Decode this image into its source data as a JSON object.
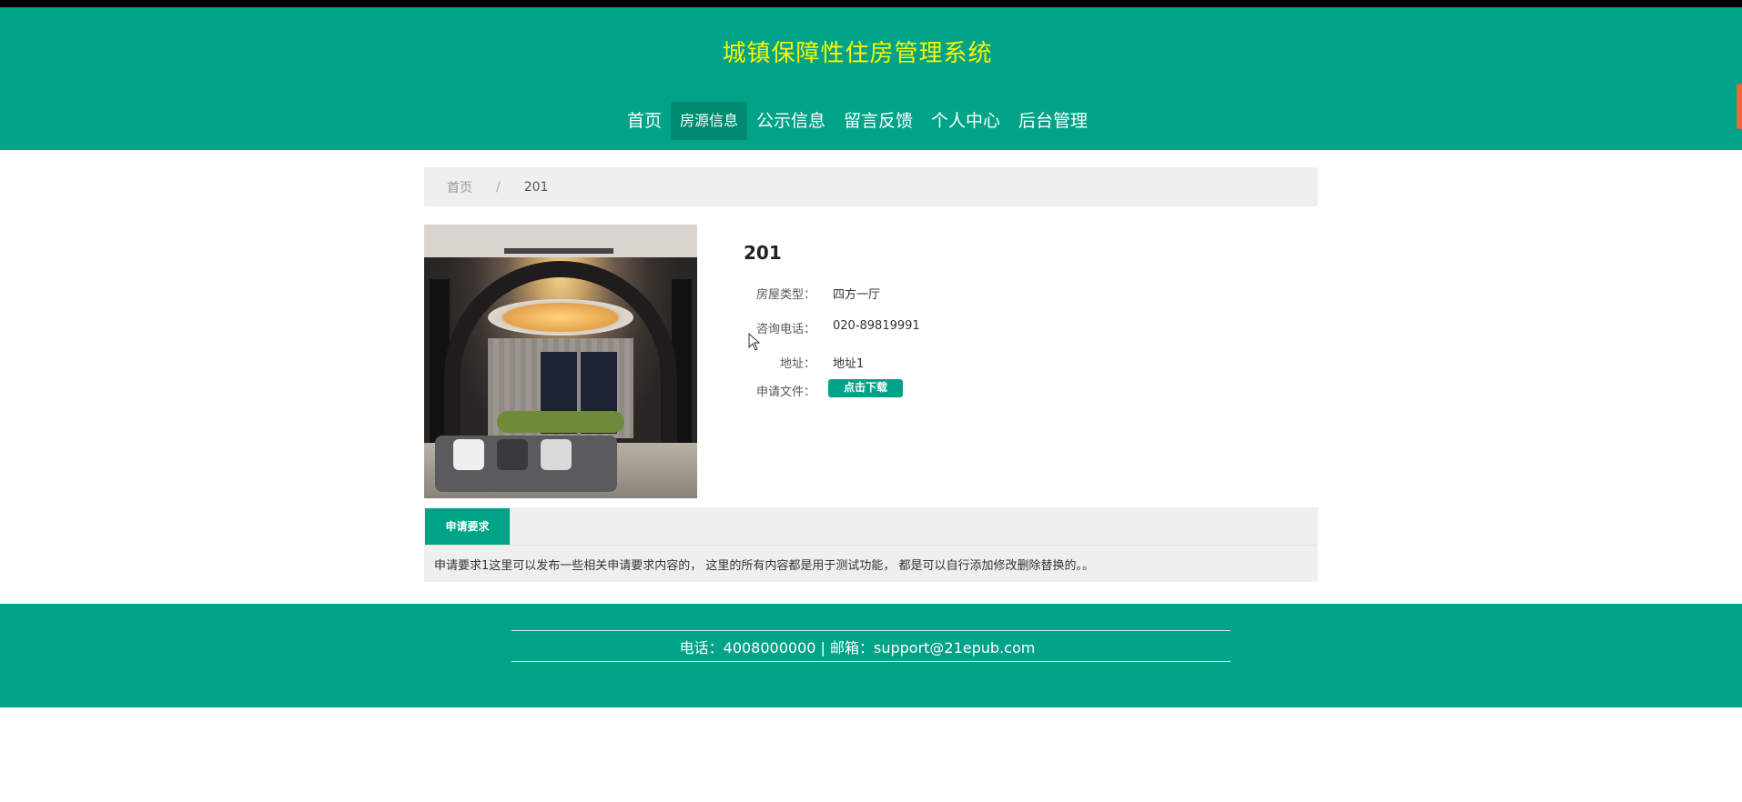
{
  "header": {
    "site_title": "城镇保障性住房管理系统",
    "nav": [
      {
        "label": "首页",
        "active": false
      },
      {
        "label": "房源信息",
        "active": true
      },
      {
        "label": "公示信息",
        "active": false
      },
      {
        "label": "留言反馈",
        "active": false
      },
      {
        "label": "个人中心",
        "active": false
      },
      {
        "label": "后台管理",
        "active": false
      }
    ]
  },
  "breadcrumb": {
    "home": "首页",
    "separator": "/",
    "current": "201"
  },
  "listing": {
    "title": "201",
    "fields": [
      {
        "label": "房屋类型：",
        "value": "四方一厅"
      },
      {
        "label": "咨询电话：",
        "value": "020-89819991"
      },
      {
        "label": "地址：",
        "value": "地址1"
      }
    ],
    "file_label": "申请文件：",
    "download_button": "点击下载"
  },
  "tabs": {
    "active_label": "申请要求",
    "content": "申请要求1这里可以发布一些相关申请要求内容的， 这里的所有内容都是用于测试功能， 都是可以自行添加修改删除替换的。。"
  },
  "footer": {
    "contact": "电话：4008000000 | 邮箱：support@21epub.com"
  },
  "colors": {
    "brand_green": "#00a388",
    "title_yellow": "#f7f700",
    "nav_active": "#008a72",
    "panel_gray": "#efefef"
  }
}
